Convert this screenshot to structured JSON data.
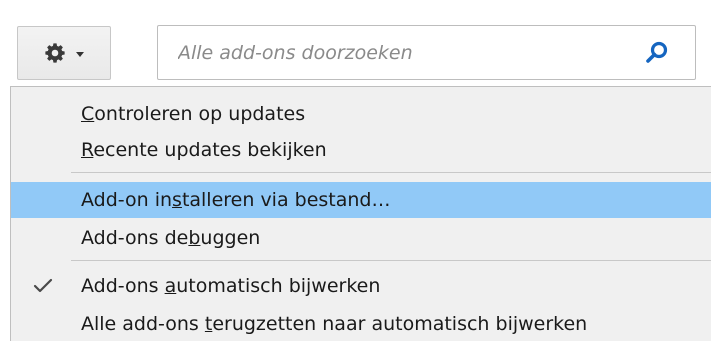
{
  "toolbar": {
    "gear_icon": "gear-icon",
    "dropdown_icon": "chevron-down-icon"
  },
  "search": {
    "placeholder": "Alle add-ons doorzoeken",
    "value": "",
    "icon": "search-icon"
  },
  "menu": {
    "items": [
      {
        "pre": "",
        "acc": "C",
        "post": "ontroleren op updates",
        "checked": false,
        "highlighted": false
      },
      {
        "pre": "",
        "acc": "R",
        "post": "ecente updates bekijken",
        "checked": false,
        "highlighted": false
      },
      {
        "pre": "Add-on in",
        "acc": "s",
        "post": "talleren via bestand…",
        "checked": false,
        "highlighted": true
      },
      {
        "pre": "Add-ons de",
        "acc": "b",
        "post": "uggen",
        "checked": false,
        "highlighted": false
      },
      {
        "pre": "Add-ons ",
        "acc": "a",
        "post": "utomatisch bijwerken",
        "checked": true,
        "highlighted": false
      },
      {
        "pre": "Alle add-ons ",
        "acc": "t",
        "post": "erugzetten naar automatisch bijwerken",
        "checked": false,
        "highlighted": false
      }
    ]
  },
  "colors": {
    "highlight": "#91c9f7",
    "menu_bg": "#f0f0f0",
    "search_icon": "#1565c0"
  }
}
